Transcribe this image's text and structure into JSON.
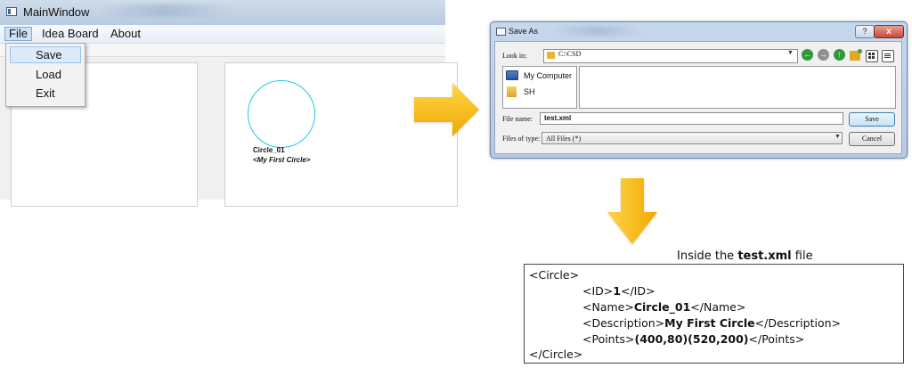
{
  "main_window": {
    "title": "MainWindow",
    "menubar": {
      "file": "File",
      "idea_board": "Idea Board",
      "about": "About"
    },
    "file_menu": {
      "save": "Save",
      "load": "Load",
      "exit": "Exit"
    },
    "canvas": {
      "circle": {
        "name": "Circle_01",
        "description": "<My First Circle>",
        "color": "#23c4e6"
      }
    }
  },
  "save_dialog": {
    "title": "Save As",
    "look_in_label": "Look in:",
    "look_in_value": "C:\\CSD",
    "sidebar": [
      {
        "label": "My Computer",
        "icon": "computer-icon"
      },
      {
        "label": "SH",
        "icon": "user-folder-icon"
      }
    ],
    "file_name_label": "File name:",
    "file_name_value": "test.xml",
    "file_type_label": "Files of type:",
    "file_type_value": "All Files (*)",
    "save_button": "Save",
    "cancel_button": "Cancel",
    "help_button": "?",
    "close_button": "x"
  },
  "xml_file": {
    "caption_prefix": "Inside the",
    "caption_file": "test.xml",
    "caption_suffix": "file",
    "circle_open": "<Circle>",
    "circle_close": "</Circle>",
    "id": {
      "open": "<ID>",
      "value": "1",
      "close": "</ID>"
    },
    "name": {
      "open": "<Name>",
      "value": "Circle_01",
      "close": "</Name>"
    },
    "description": {
      "open": "<Description>",
      "value": "My First Circle",
      "close": "</Description>"
    },
    "points": {
      "open": "<Points>",
      "value": "(400,80)(520,200)",
      "close": "</Points>"
    }
  },
  "colors": {
    "arrow": "#f5b400",
    "accent": "#23c4e6"
  }
}
